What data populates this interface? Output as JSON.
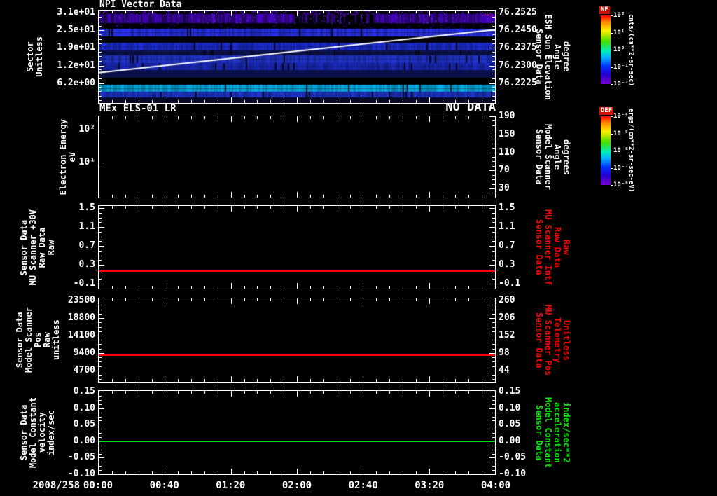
{
  "window": {
    "bg": "#000000",
    "fg": "#ffffff",
    "accent_red": "#ff0000",
    "accent_green": "#00ee00"
  },
  "time_axis": {
    "date_label": "2008/258",
    "tick_labels": [
      "00:00",
      "00:40",
      "01:20",
      "02:00",
      "02:40",
      "03:20",
      "04:00"
    ],
    "start": "2008/258 00:00",
    "end": "04:00"
  },
  "chart_data": [
    {
      "id": "npi_vector_data",
      "type": "heatmap",
      "title": "NPI Vector Data",
      "left_axis": {
        "label": "Sector\nUnitless",
        "ticks": [
          "3.1e+01",
          "2.5e+01",
          "1.9e+01",
          "1.2e+01",
          "6.2e+00"
        ],
        "tick_values": [
          31,
          25,
          19,
          12,
          6.2
        ],
        "tick_fracs": [
          0.023,
          0.212,
          0.402,
          0.598,
          0.788
        ]
      },
      "right_axis": {
        "label": "Sensor Data\nESH Sun Elevation\nAngle\ndegree",
        "ticks": [
          "76.2525",
          "76.2450",
          "76.2375",
          "76.2300",
          "76.2225"
        ],
        "tick_values": [
          76.2525,
          76.245,
          76.2375,
          76.23,
          76.2225
        ],
        "tick_fracs": [
          0.023,
          0.212,
          0.402,
          0.598,
          0.788
        ],
        "color": "#ffffff"
      },
      "colorbar": {
        "name": "NF",
        "units": "cnts/(cm**2-sr-sec)",
        "ticks": [
          "10²",
          "10¹",
          "10⁰",
          "10⁻¹",
          "10⁻²"
        ]
      },
      "overlay_line": {
        "color": "#ffffff",
        "start_value": 76.227,
        "end_value": 76.2453
      },
      "bands": [
        {
          "y0": 0.0,
          "y1": 0.038,
          "color": "#6600ee",
          "texture": "speckle",
          "density": 0.3
        },
        {
          "y0": 0.038,
          "y1": 0.136,
          "color": "#4a00d0",
          "texture": "noisy"
        },
        {
          "y0": 0.136,
          "y1": 0.197,
          "color": "#30008c",
          "texture": "speckle",
          "density": 0.1
        },
        {
          "y0": 0.197,
          "y1": 0.28,
          "color": "#2a35f0",
          "texture": "striped"
        },
        {
          "y0": 0.28,
          "y1": 0.348,
          "color": "#020208",
          "texture": "solid"
        },
        {
          "y0": 0.348,
          "y1": 0.432,
          "color": "#2030e0",
          "texture": "striped"
        },
        {
          "y0": 0.432,
          "y1": 0.485,
          "color": "#0c1455",
          "texture": "striped"
        },
        {
          "y0": 0.485,
          "y1": 0.568,
          "color": "#2438d8",
          "texture": "striped"
        },
        {
          "y0": 0.568,
          "y1": 0.644,
          "color": "#1c2cc8",
          "texture": "striped"
        },
        {
          "y0": 0.644,
          "y1": 0.727,
          "color": "#0a1048",
          "texture": "solid"
        },
        {
          "y0": 0.727,
          "y1": 0.803,
          "color": "#010104",
          "texture": "solid"
        },
        {
          "y0": 0.803,
          "y1": 0.879,
          "color": "#00b8f0",
          "texture": "striped"
        },
        {
          "y0": 0.879,
          "y1": 0.939,
          "color": "#2038d8",
          "texture": "striped"
        },
        {
          "y0": 0.939,
          "y1": 1.0,
          "color": "#060a24",
          "texture": "solid"
        }
      ],
      "x_range": [
        "00:00",
        "04:00"
      ]
    },
    {
      "id": "mex_els_01_lr",
      "type": "heatmap",
      "title": "MEx ELS-01 LR",
      "status": "NO DATA",
      "left_axis": {
        "label": "Electron Energy\neV",
        "ticks": [
          "10²",
          "10¹"
        ],
        "tick_fracs": [
          0.164,
          0.569
        ],
        "log": true
      },
      "right_axis": {
        "label": "Sensor Data\nModel Scanner\nAngle\ndegrees",
        "ticks": [
          "190",
          "150",
          "110",
          "70",
          "30"
        ],
        "tick_values": [
          190,
          150,
          110,
          70,
          30
        ],
        "tick_fracs": [
          0.0,
          0.222,
          0.444,
          0.666,
          0.888
        ],
        "color": "#ffffff"
      },
      "colorbar": {
        "name": "DEF",
        "units": "ergs/(cm**2-sr-sec-eV)",
        "ticks": [
          "10⁻⁴",
          "10⁻⁵",
          "10⁻⁶",
          "10⁻⁷",
          "10⁻⁸"
        ]
      },
      "bands": []
    },
    {
      "id": "mu_scanner_30v_raw",
      "type": "line",
      "left_axis": {
        "label": "Sensor Data\nMU Scanner +30V\nRaw Data\nRaw",
        "ticks": [
          "1.5",
          "1.1",
          "0.7",
          "0.3",
          "-0.1"
        ],
        "tick_values": [
          1.5,
          1.1,
          0.7,
          0.3,
          -0.1
        ],
        "tick_fracs": [
          0.025,
          0.254,
          0.483,
          0.712,
          0.941
        ]
      },
      "right_axis": {
        "label": "Sensor Data\nMU Scanner Intf\nRaw Data\nRaw",
        "ticks": [
          "1.5",
          "1.1",
          "0.7",
          "0.3",
          "-0.1"
        ],
        "tick_values": [
          1.5,
          1.1,
          0.7,
          0.3,
          -0.1
        ],
        "tick_fracs": [
          0.025,
          0.254,
          0.483,
          0.712,
          0.941
        ],
        "color": "#ff0000"
      },
      "series": [
        {
          "name": "mu-scanner-30v-raw",
          "color": "#ff0000",
          "constant_value": 0.17
        }
      ]
    },
    {
      "id": "model_scanner_pos_raw",
      "type": "line",
      "left_axis": {
        "label": "Sensor Data\nModel Scanner Pos\nRaw\nunitless",
        "ticks": [
          "23500",
          "18800",
          "14100",
          "9400",
          "4700"
        ],
        "tick_values": [
          23500,
          18800,
          14100,
          9400,
          4700
        ],
        "tick_fracs": [
          0.025,
          0.235,
          0.445,
          0.655,
          0.866
        ]
      },
      "right_axis": {
        "label": "Sensor Data\nMU Scanner Pos\nTelemetry\nUnitless",
        "ticks": [
          "260",
          "206",
          "152",
          "98",
          "44"
        ],
        "tick_values": [
          260,
          206,
          152,
          98,
          44
        ],
        "tick_fracs": [
          0.025,
          0.235,
          0.445,
          0.655,
          0.866
        ],
        "color": "#ff0000"
      },
      "series": [
        {
          "name": "model-scanner-pos-raw",
          "color": "#ff0000",
          "constant_value": 8800
        }
      ]
    },
    {
      "id": "model_constant_velocity",
      "type": "line",
      "left_axis": {
        "label": "Sensor Data\nModel Constant\nvelocity\nindex/sec",
        "ticks": [
          "0.15",
          "0.10",
          "0.05",
          "0.00",
          "-0.05",
          "-0.10"
        ],
        "tick_values": [
          0.15,
          0.1,
          0.05,
          0.0,
          -0.05,
          -0.1
        ],
        "tick_fracs": [
          0.01,
          0.208,
          0.406,
          0.604,
          0.802,
          1.0
        ]
      },
      "right_axis": {
        "label": "Sensor Data\nModel Constant\nacceleration\nindex/sec**2",
        "ticks": [
          "0.15",
          "0.10",
          "0.05",
          "0.00",
          "-0.05",
          "-0.10"
        ],
        "tick_values": [
          0.15,
          0.1,
          0.05,
          0.0,
          -0.05,
          -0.1
        ],
        "tick_fracs": [
          0.01,
          0.208,
          0.406,
          0.604,
          0.802,
          1.0
        ],
        "color": "#00ee00"
      },
      "series": [
        {
          "name": "model-constant-velocity",
          "color": "#00dd22",
          "constant_value": 0.0
        }
      ]
    }
  ]
}
